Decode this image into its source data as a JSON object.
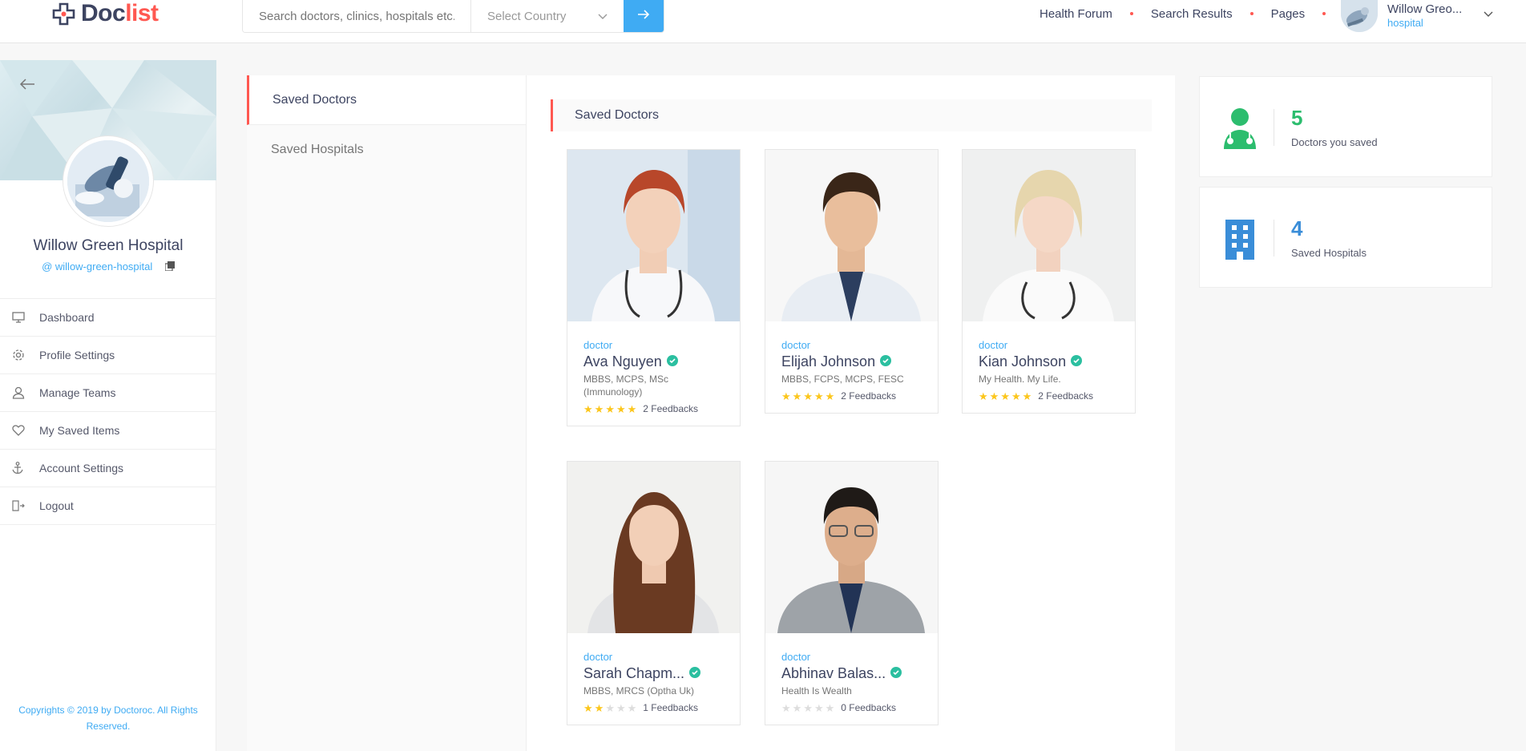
{
  "header": {
    "logo_prefix": "Doc",
    "logo_suffix": "list",
    "search_placeholder": "Search doctors, clinics, hospitals etc.",
    "country_label": "Select Country",
    "nav": [
      "Health Forum",
      "Search Results",
      "Pages"
    ],
    "user_name": "Willow Greo...",
    "user_role": "hospital"
  },
  "sidebar": {
    "name": "Willow Green Hospital",
    "handle": "@ willow-green-hospital",
    "menu": [
      {
        "label": "Dashboard",
        "icon": "monitor-icon"
      },
      {
        "label": "Profile Settings",
        "icon": "gear-icon"
      },
      {
        "label": "Manage Teams",
        "icon": "user-icon"
      },
      {
        "label": "My Saved Items",
        "icon": "heart-icon"
      },
      {
        "label": "Account Settings",
        "icon": "anchor-icon"
      },
      {
        "label": "Logout",
        "icon": "logout-icon"
      }
    ],
    "copyright": "Copyrights © 2019 by Doctoroc. All Rights Reserved."
  },
  "tabs": [
    "Saved Doctors",
    "Saved Hospitals"
  ],
  "section_title": "Saved Doctors",
  "doctors": [
    {
      "category": "doctor",
      "name": "Ava Nguyen",
      "degrees": "MBBS, MCPS, MSc (Immunology)",
      "rating": 5,
      "feedback": "2 Feedbacks"
    },
    {
      "category": "doctor",
      "name": "Elijah Johnson",
      "degrees": "MBBS, FCPS, MCPS, FESC",
      "rating": 5,
      "feedback": "2 Feedbacks"
    },
    {
      "category": "doctor",
      "name": "Kian Johnson",
      "degrees": "My Health. My Life.",
      "rating": 5,
      "feedback": "2 Feedbacks"
    },
    {
      "category": "doctor",
      "name": "Sarah Chapm...",
      "degrees": "MBBS, MRCS (Optha Uk)",
      "rating": 2,
      "feedback": "1 Feedbacks"
    },
    {
      "category": "doctor",
      "name": "Abhinav Balas...",
      "degrees": "Health Is Wealth",
      "rating": 0,
      "feedback": "0 Feedbacks"
    }
  ],
  "stats": [
    {
      "value": "5",
      "label": "Doctors you saved",
      "color": "#2cbd6e",
      "icon": "doctor-icon"
    },
    {
      "value": "4",
      "label": "Saved Hospitals",
      "color": "#3a8dd8",
      "icon": "hospital-building-icon"
    }
  ],
  "colors": {
    "accent_red": "#ff5851",
    "accent_blue": "#3fabf3",
    "star": "#fcc61b",
    "verified": "#2bbfa0"
  }
}
